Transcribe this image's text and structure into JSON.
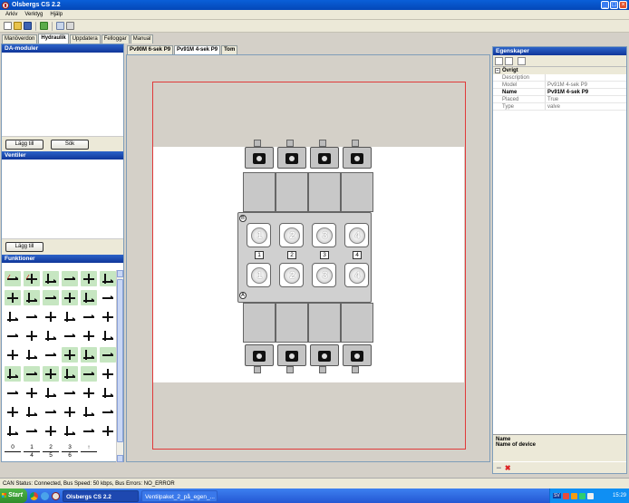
{
  "titlebar": {
    "title": "Olsbergs CS 2.2"
  },
  "menu": {
    "items": [
      "Arkiv",
      "Verktyg",
      "Hjälp"
    ]
  },
  "main_tabs": [
    "Manöverdon",
    "Hydraulik",
    "Uppdatera",
    "Felloggar",
    "Manual"
  ],
  "left": {
    "da_title": "DA-moduler",
    "add_label": "Lägg till",
    "search_label": "Sök",
    "valves_title": "Ventiler",
    "valves_add_label": "Lägg till",
    "functions_title": "Funktioner",
    "function_rows": [
      [
        "red1",
        "red2",
        "green",
        "green",
        "green",
        "green"
      ],
      [
        "green",
        "green",
        "green",
        "green",
        "green",
        "plain"
      ],
      [
        "plain",
        "plain",
        "plain",
        "plain",
        "plain",
        "plain"
      ],
      [
        "plain",
        "plain",
        "plain",
        "plain",
        "plain",
        "plain"
      ],
      [
        "plain",
        "plain",
        "plain",
        "green",
        "green",
        "green"
      ],
      [
        "green",
        "green",
        "green",
        "green",
        "green",
        "plain"
      ],
      [
        "plain",
        "plain",
        "plain",
        "plain",
        "plain",
        "plain"
      ],
      [
        "plain",
        "plain",
        "plain",
        "plain",
        "plain",
        "plain"
      ],
      [
        "plain",
        "plain",
        "plain",
        "plain",
        "plain",
        "plain"
      ]
    ],
    "number_row": [
      {
        "top": "0",
        "bottom": ""
      },
      {
        "top": "1",
        "bottom": "4"
      },
      {
        "top": "2",
        "bottom": "5"
      },
      {
        "top": "3",
        "bottom": "6"
      },
      {
        "top": "↑",
        "bottom": ""
      }
    ]
  },
  "doc_tabs": [
    "Pv90M 6-sek P9",
    "Pv91M 4-sek P9",
    "Tom"
  ],
  "diagram": {
    "port_b": "B",
    "port_a": "A",
    "sections": [
      "1",
      "2",
      "3",
      "4"
    ]
  },
  "properties": {
    "title": "Egenskaper",
    "category": "Övrigt",
    "rows": [
      {
        "key": "Description",
        "value": ""
      },
      {
        "key": "Model",
        "value": "Pv91M 4-sek P9"
      },
      {
        "key": "Name",
        "value": "Pv91M 4-sek P9"
      },
      {
        "key": "Placed",
        "value": "True"
      },
      {
        "key": "Type",
        "value": "valve"
      }
    ],
    "desc_title": "Name",
    "desc_text": "Name of device"
  },
  "status": {
    "text": "CAN Status: Connected, Bus Speed: 50 kbps, Bus Errors: NO_ERROR"
  },
  "taskbar": {
    "start_label": "Start",
    "task1": "Olsbergs CS 2.2",
    "task2": "Ventilpaket_2_på_egen_...",
    "lang": "SV",
    "clock": "15:29"
  }
}
